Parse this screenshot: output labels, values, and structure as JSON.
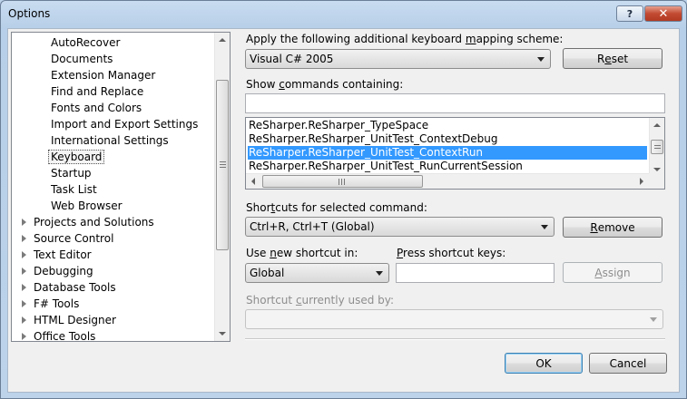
{
  "window": {
    "title": "Options",
    "help_label": "?",
    "close_label": "✕"
  },
  "tree": {
    "items": [
      {
        "label": "AutoRecover",
        "indent": 1
      },
      {
        "label": "Documents",
        "indent": 1
      },
      {
        "label": "Extension Manager",
        "indent": 1
      },
      {
        "label": "Find and Replace",
        "indent": 1
      },
      {
        "label": "Fonts and Colors",
        "indent": 1
      },
      {
        "label": "Import and Export Settings",
        "indent": 1
      },
      {
        "label": "International Settings",
        "indent": 1
      },
      {
        "label": "Keyboard",
        "indent": 1,
        "selected": true
      },
      {
        "label": "Startup",
        "indent": 1
      },
      {
        "label": "Task List",
        "indent": 1
      },
      {
        "label": "Web Browser",
        "indent": 1
      },
      {
        "label": "Projects and Solutions",
        "indent": 0,
        "collapsed": true
      },
      {
        "label": "Source Control",
        "indent": 0,
        "collapsed": true
      },
      {
        "label": "Text Editor",
        "indent": 0,
        "collapsed": true
      },
      {
        "label": "Debugging",
        "indent": 0,
        "collapsed": true
      },
      {
        "label": "Database Tools",
        "indent": 0,
        "collapsed": true
      },
      {
        "label": "F# Tools",
        "indent": 0,
        "collapsed": true
      },
      {
        "label": "HTML Designer",
        "indent": 0,
        "collapsed": true
      },
      {
        "label": "Office Tools",
        "indent": 0,
        "collapsed": true
      }
    ]
  },
  "mapping": {
    "label_pre": "Apply the following additional keyboard ",
    "label_key": "m",
    "label_post": "apping scheme:",
    "value": "Visual C# 2005",
    "reset_pre": "R",
    "reset_key": "e",
    "reset_post": "set"
  },
  "commands": {
    "label_pre": "Show ",
    "label_key": "c",
    "label_post": "ommands containing:",
    "filter_value": "",
    "items": [
      {
        "label": "ReSharper.ReSharper_TypeSpace",
        "selected": false
      },
      {
        "label": "ReSharper.ReSharper_UnitTest_ContextDebug",
        "selected": false
      },
      {
        "label": "ReSharper.ReSharper_UnitTest_ContextRun",
        "selected": true
      },
      {
        "label": "ReSharper.ReSharper_UnitTest_RunCurrentSession",
        "selected": false
      }
    ]
  },
  "shortcuts": {
    "label_pre": "Shor",
    "label_key": "t",
    "label_post": "cuts for selected command:",
    "value": "Ctrl+R, Ctrl+T (Global)",
    "remove_pre": "",
    "remove_key": "R",
    "remove_post": "emove"
  },
  "use_in": {
    "label_pre": "Use ",
    "label_key": "n",
    "label_post": "ew shortcut in:",
    "value": "Global"
  },
  "press_keys": {
    "label_pre": "",
    "label_key": "P",
    "label_post": "ress shortcut keys:",
    "value": "",
    "assign_pre": "",
    "assign_key": "A",
    "assign_post": "ssign"
  },
  "used_by": {
    "label_pre": "Shortcut ",
    "label_key": "c",
    "label_post": "urrently used by:",
    "value": ""
  },
  "footer": {
    "ok_label": "OK",
    "cancel_label": "Cancel"
  }
}
